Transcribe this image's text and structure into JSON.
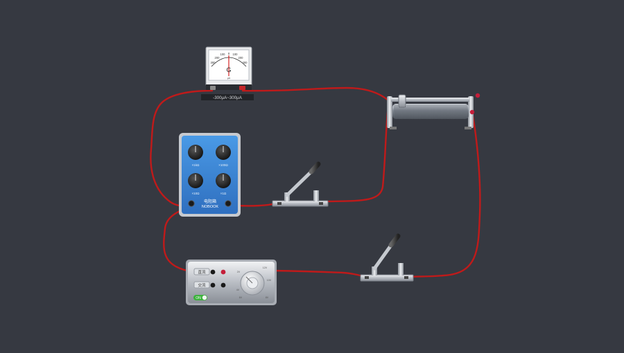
{
  "galvanometer": {
    "symbol": "G",
    "range_label": "-300μA~300μA",
    "scale_ticks": [
      "300",
      "200",
      "100",
      "0",
      "100",
      "200",
      "300"
    ],
    "zero_label": "μA"
  },
  "resistance_box": {
    "brand_cn": "电阻箱",
    "brand_en": "NOBOOK",
    "knob_labels": [
      "×1kΩ",
      "×100Ω",
      "×10Ω",
      "×1Ω"
    ]
  },
  "power_supply": {
    "dc_label": "直流",
    "ac_label": "交流",
    "switch_label": "ON",
    "dial_labels": [
      "2V",
      "4V",
      "6V",
      "8V",
      "10V",
      "12V"
    ]
  },
  "colors": {
    "background": "#363941",
    "wire": "#c01a1a",
    "resistance_box_blue": "#3a87d6"
  }
}
